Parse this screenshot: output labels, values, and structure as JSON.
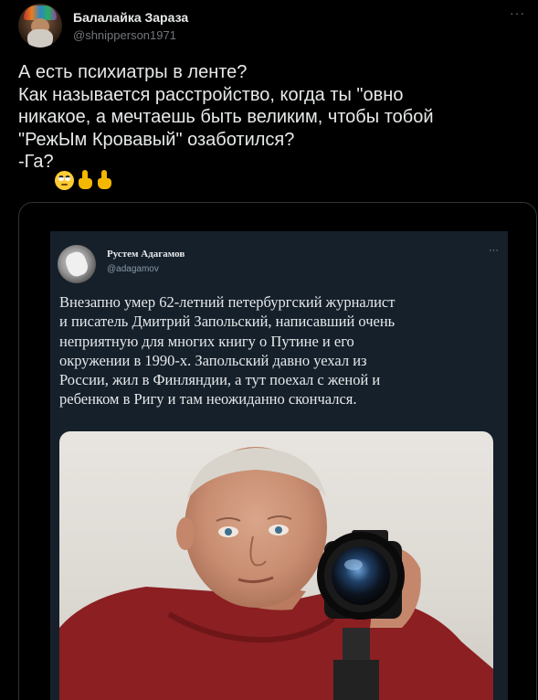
{
  "tweet": {
    "display_name": "Балалайка Зараза",
    "handle": "@shnipperson1971",
    "more_icon": "more-icon",
    "lines": [
      "А есть психиатры в ленте?",
      "Как называется расстройство, когда ты \"овно",
      "никакое, а мечтаешь быть великим, чтобы тобой",
      "\"РежЫм Кровавый\" озаботился?"
    ],
    "last_line_prefix": "-Га?",
    "emojis": [
      "face-with-rolling-eyes-icon",
      "pointing-up-hand-icon",
      "pointing-up-hand-icon"
    ]
  },
  "quoted": {
    "display_name": "Рустем Адагамов",
    "handle": "@adagamov",
    "more_icon": "more-icon",
    "lines": [
      "Внезапно умер 62-летний петербургский журналист",
      "и писатель Дмитрий Запольский, написавший очень",
      "неприятную для многих книгу о Путине и его",
      "окружении в 1990-х. Запольский давно уехал из",
      "России, жил в Финляндии, а тут поехал с женой и",
      "ребенком в Ригу и там неожиданно скончался."
    ],
    "photo": "photo-of-man-with-camera"
  },
  "colors": {
    "background": "#000000",
    "inner_background": "#15202b",
    "text": "#e7e9ea",
    "muted": "#71767b",
    "border": "#2f3336"
  }
}
